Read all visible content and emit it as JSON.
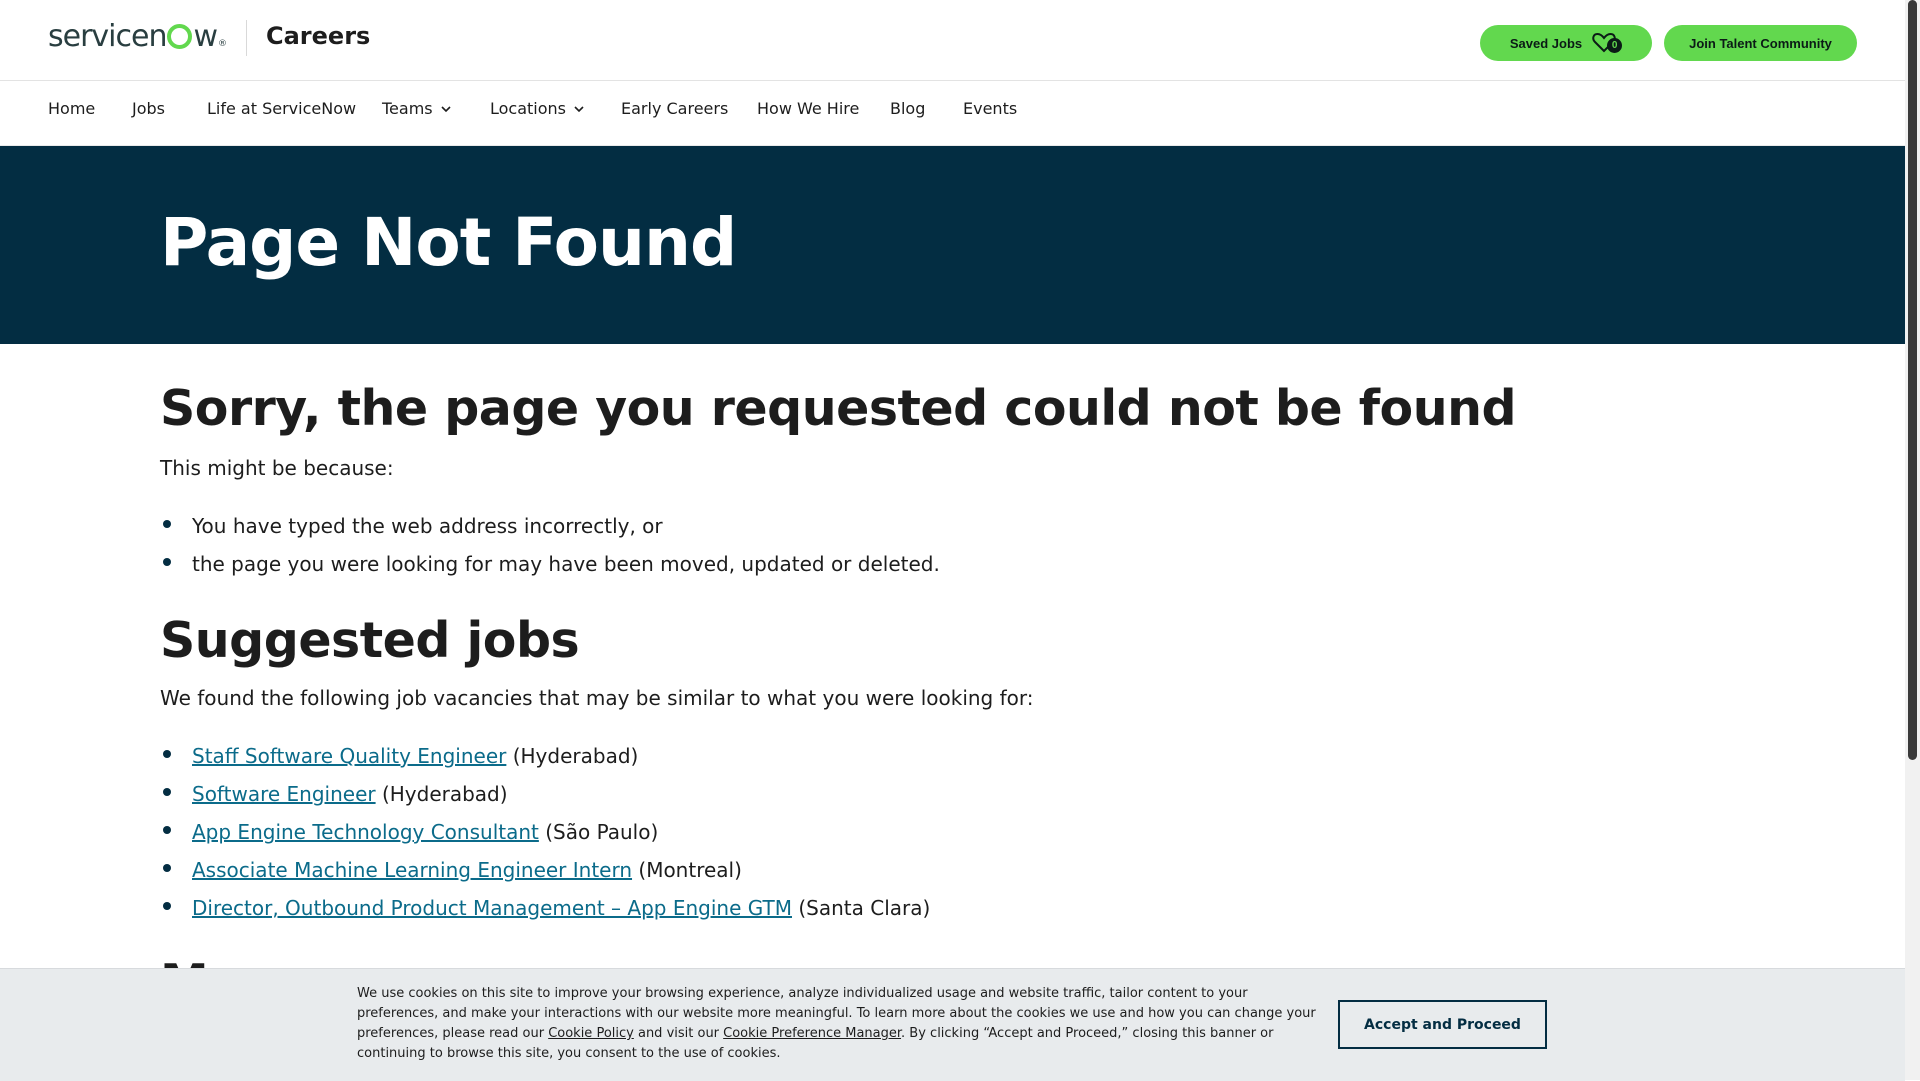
{
  "header": {
    "logo_text": "servicenow",
    "section_title": "Careers",
    "saved_jobs_label": "Saved Jobs",
    "saved_jobs_count": "0",
    "join_label": "Join Talent Community"
  },
  "nav": {
    "items": [
      {
        "label": "Home"
      },
      {
        "label": "Jobs"
      },
      {
        "label": "Life at ServiceNow"
      },
      {
        "label": "Teams",
        "dropdown": true
      },
      {
        "label": "Locations",
        "dropdown": true
      },
      {
        "label": "Early Careers"
      },
      {
        "label": "How We Hire"
      },
      {
        "label": "Blog"
      },
      {
        "label": "Events"
      }
    ]
  },
  "hero": {
    "title": "Page Not Found"
  },
  "content": {
    "sorry_heading": "Sorry, the page you requested could not be found",
    "reason_intro": "This might be because:",
    "reasons": [
      "You have typed the web address incorrectly, or",
      "the page you were looking for may have been moved, updated or deleted."
    ],
    "suggested_heading": "Suggested jobs",
    "suggested_intro": "We found the following job vacancies that may be similar to what you were looking for:",
    "jobs": [
      {
        "title": "Staff Software Quality Engineer",
        "location": "(Hyderabad)"
      },
      {
        "title": "Software Engineer",
        "location": "(Hyderabad)"
      },
      {
        "title": "App Engine Technology Consultant",
        "location": "(São Paulo)"
      },
      {
        "title": "Associate Machine Learning Engineer Intern",
        "location": "(Montreal)"
      },
      {
        "title": "Director, Outbound Product Management – App Engine GTM",
        "location": "(Santa Clara)"
      }
    ],
    "next_heading_partial": "More search"
  },
  "cookie": {
    "text_1": "We use cookies on this site to improve your browsing experience, analyze individualized usage and website traffic, tailor content to your preferences, and make your interactions with our website more meaningful. To learn more about the cookies we use and how you can change your preferences, please read our ",
    "cookie_policy_link": "Cookie Policy",
    "text_2": " and visit our ",
    "preference_link": "Cookie Preference Manager",
    "text_3": ". By clicking “Accept and Proceed,” closing this banner or continuing to browse this site, you consent to the use of cookies.",
    "accept_label": "Accept and Proceed"
  },
  "colors": {
    "brand_green": "#62d84e",
    "hero_navy": "#032d42",
    "link_teal": "#0b6b8a"
  }
}
